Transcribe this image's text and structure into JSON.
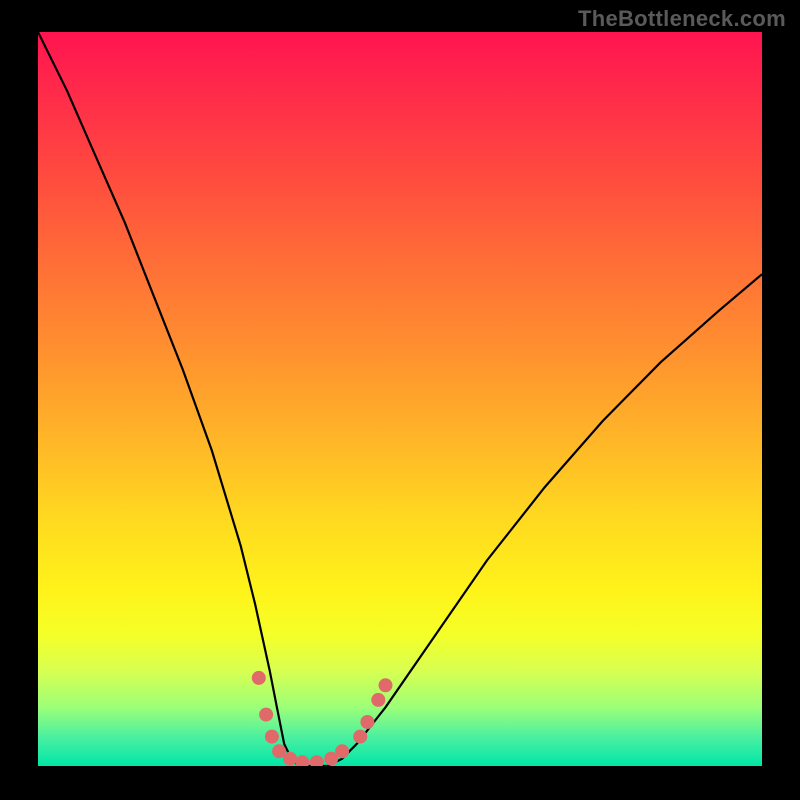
{
  "watermark": "TheBottleneck.com",
  "chart_data": {
    "type": "line",
    "title": "",
    "xlabel": "",
    "ylabel": "",
    "xlim": [
      0,
      100
    ],
    "ylim": [
      0,
      100
    ],
    "grid": false,
    "background_gradient_meaning": "green (bottom) = low bottleneck, red (top) = high bottleneck",
    "series": [
      {
        "name": "bottleneck-curve",
        "x": [
          0,
          4,
          8,
          12,
          16,
          20,
          24,
          28,
          30,
          32,
          33,
          34,
          35,
          36,
          38,
          40,
          42,
          44,
          48,
          55,
          62,
          70,
          78,
          86,
          94,
          100
        ],
        "y": [
          100,
          92,
          83,
          74,
          64,
          54,
          43,
          30,
          22,
          13,
          8,
          3,
          1,
          0,
          0,
          0,
          1,
          3,
          8,
          18,
          28,
          38,
          47,
          55,
          62,
          67
        ]
      }
    ],
    "markers": [
      {
        "x": 30.5,
        "y": 12
      },
      {
        "x": 31.5,
        "y": 7
      },
      {
        "x": 32.3,
        "y": 4
      },
      {
        "x": 33.3,
        "y": 2
      },
      {
        "x": 34.8,
        "y": 1
      },
      {
        "x": 36.5,
        "y": 0.5
      },
      {
        "x": 38.5,
        "y": 0.5
      },
      {
        "x": 40.5,
        "y": 1
      },
      {
        "x": 42.0,
        "y": 2
      },
      {
        "x": 44.5,
        "y": 4
      },
      {
        "x": 45.5,
        "y": 6
      },
      {
        "x": 47.0,
        "y": 9
      },
      {
        "x": 48.0,
        "y": 11
      }
    ],
    "marker_color": "#e06a6a",
    "curve_color": "#000000"
  }
}
